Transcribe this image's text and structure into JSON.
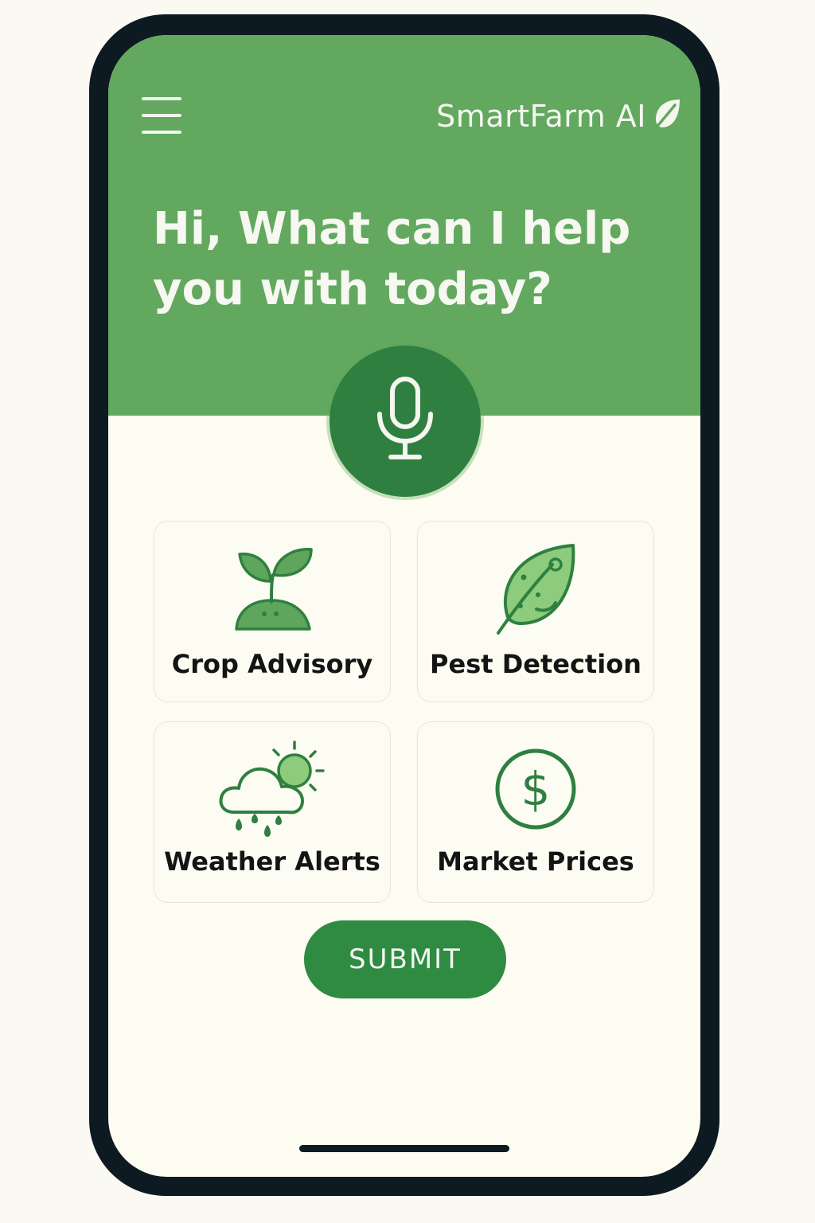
{
  "app": {
    "brand_name": "SmartFarm AI",
    "brand_icon": "leaf-icon",
    "menu_icon": "hamburger-menu-icon"
  },
  "greeting": {
    "text": "Hi, What can I help you with today?"
  },
  "voice": {
    "icon": "microphone-icon"
  },
  "cards": [
    {
      "label": "Crop Advisory",
      "icon": "sprout-icon"
    },
    {
      "label": "Pest Detection",
      "icon": "leaf-bug-icon"
    },
    {
      "label": "Weather Alerts",
      "icon": "cloud-sun-rain-icon"
    },
    {
      "label": "Market Prices",
      "icon": "dollar-coin-icon"
    }
  ],
  "submit": {
    "label": "SUBMIT"
  },
  "colors": {
    "header_green": "#62a85f",
    "primary_green": "#2f8040",
    "button_green": "#2f8a42",
    "screen_background": "#fdfcf0",
    "phone_frame": "#0e1a22"
  }
}
